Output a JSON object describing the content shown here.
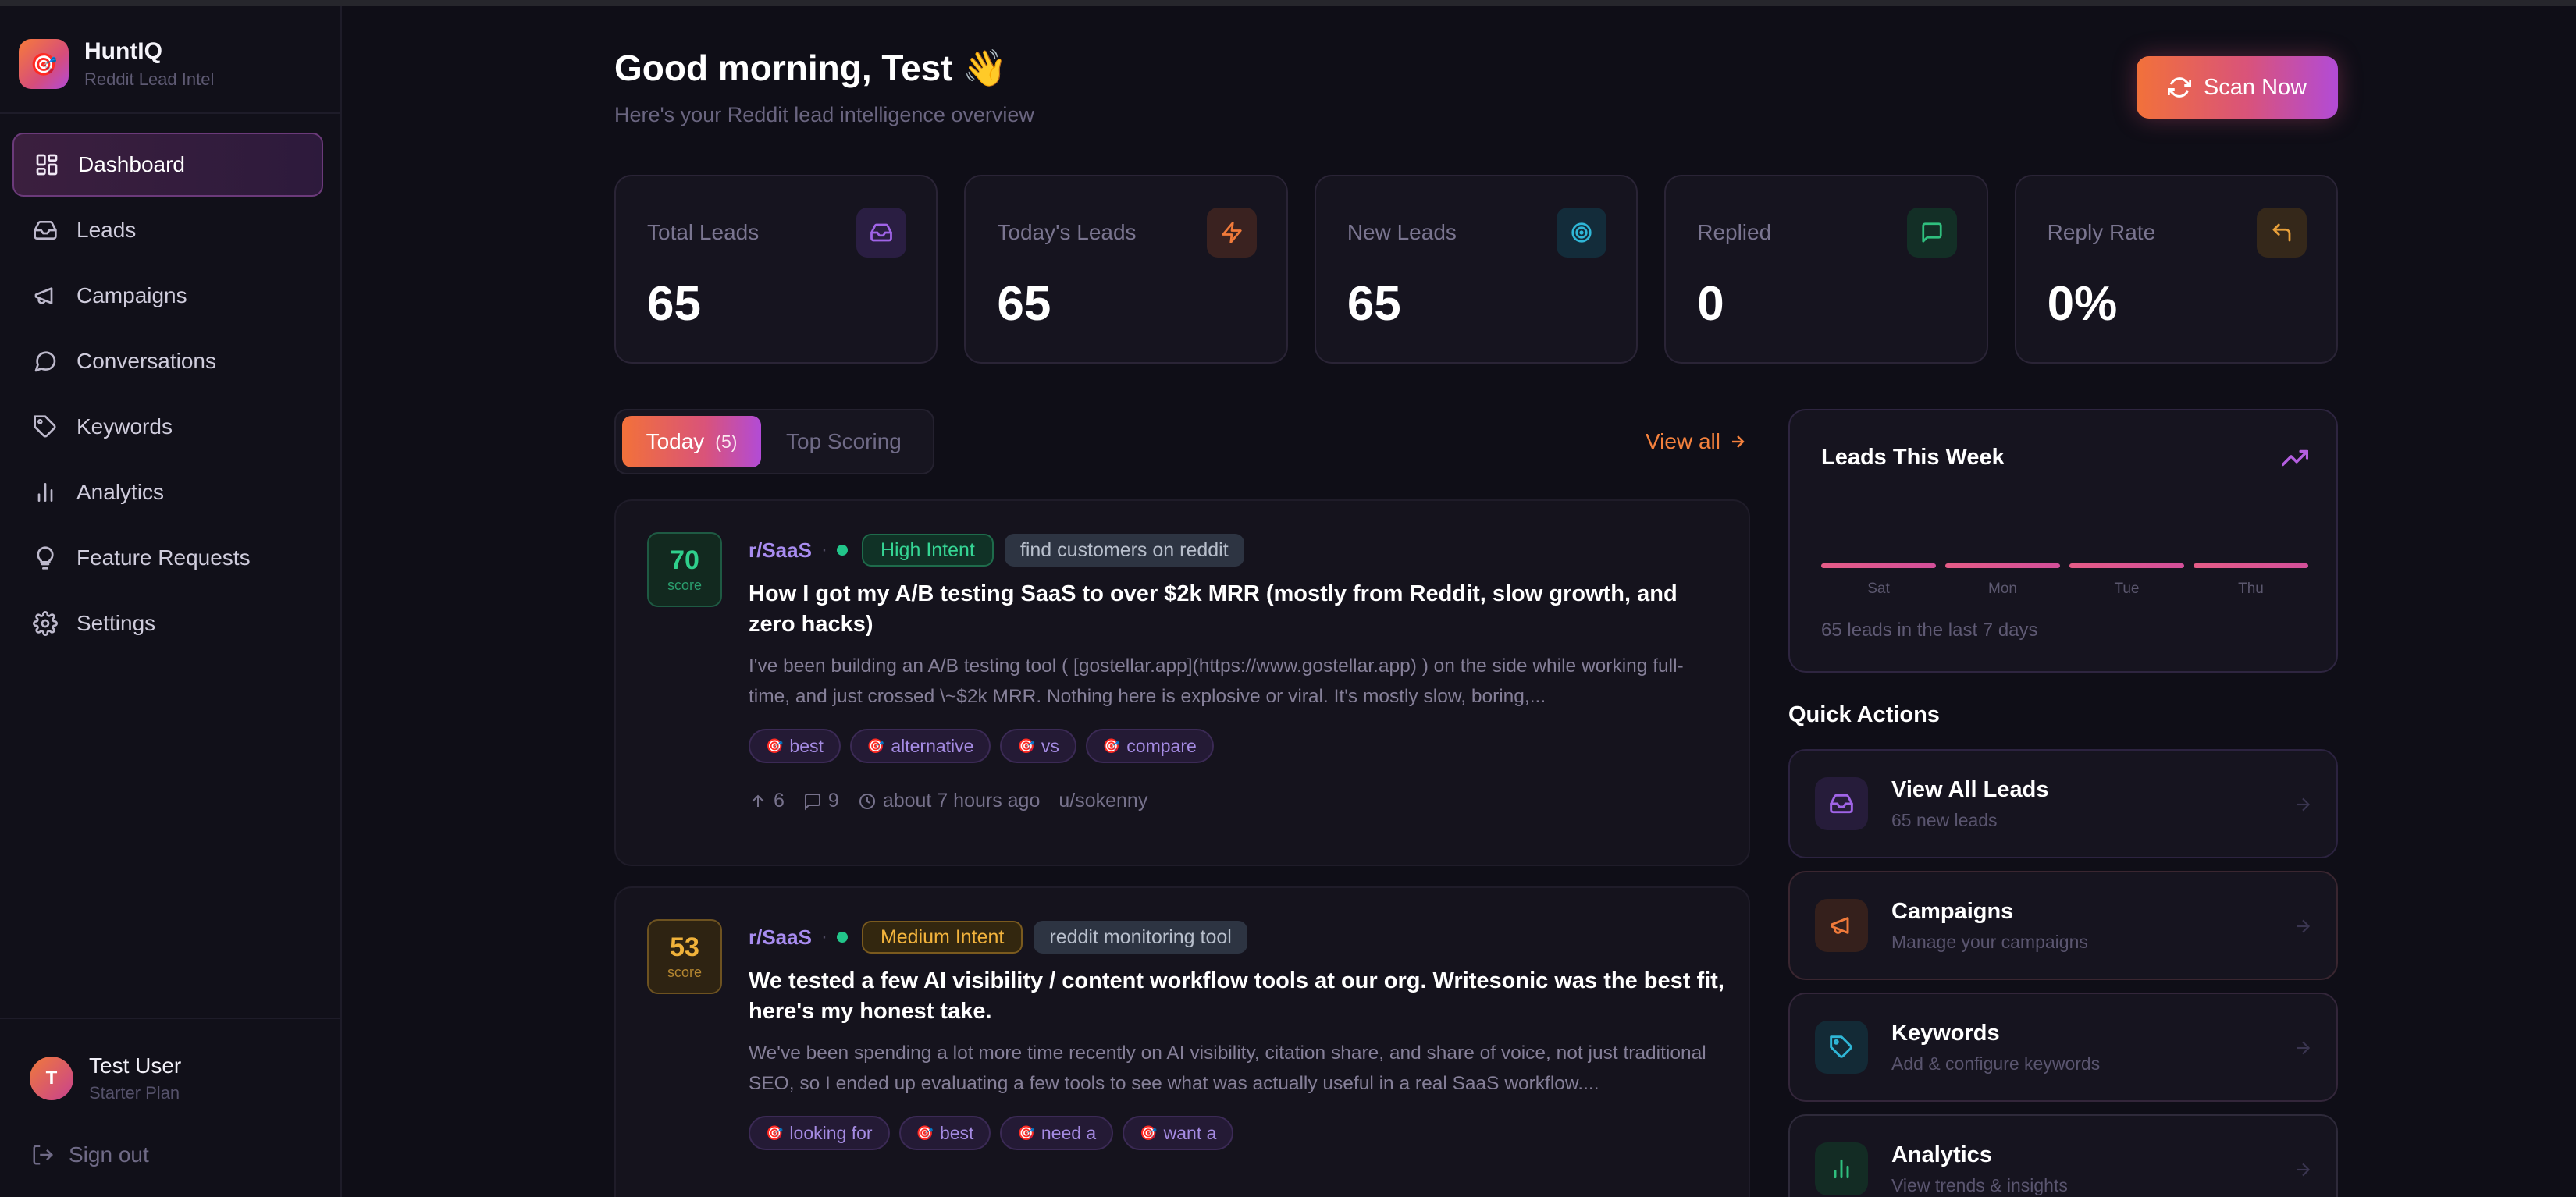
{
  "brand": {
    "name": "HuntIQ",
    "tagline": "Reddit Lead Intel"
  },
  "sidebar": {
    "items": [
      {
        "label": "Dashboard"
      },
      {
        "label": "Leads"
      },
      {
        "label": "Campaigns"
      },
      {
        "label": "Conversations"
      },
      {
        "label": "Keywords"
      },
      {
        "label": "Analytics"
      },
      {
        "label": "Feature Requests"
      },
      {
        "label": "Settings"
      }
    ],
    "active": "Dashboard"
  },
  "user": {
    "initial": "T",
    "name": "Test User",
    "plan": "Starter Plan",
    "signout": "Sign out"
  },
  "header": {
    "greeting": "Good morning, Test 👋",
    "subtitle": "Here's your Reddit lead intelligence overview",
    "scan_label": "Scan Now"
  },
  "stats": [
    {
      "label": "Total Leads",
      "value": "65",
      "icon": "inbox-icon",
      "color": "#a064e8"
    },
    {
      "label": "Today's Leads",
      "value": "65",
      "icon": "lightning-icon",
      "color": "#f07a3a"
    },
    {
      "label": "New Leads",
      "value": "65",
      "icon": "target-icon",
      "color": "#2fb6d6"
    },
    {
      "label": "Replied",
      "value": "0",
      "icon": "message-icon",
      "color": "#2fbf7e"
    },
    {
      "label": "Reply Rate",
      "value": "0%",
      "icon": "reply-icon",
      "color": "#e8a03a"
    }
  ],
  "tabs": {
    "today_label": "Today",
    "today_count": "(5)",
    "top_label": "Top Scoring",
    "view_all": "View all"
  },
  "leads": [
    {
      "score": "70",
      "score_label": "score",
      "subreddit": "r/SaaS",
      "intent": "High Intent",
      "keyword": "find customers on reddit",
      "title": "How I got my A/B testing SaaS to over $2k MRR (mostly from Reddit, slow growth, and zero hacks)",
      "excerpt": "I've been building an A/B testing tool ( [gostellar.app](https://www.gostellar.app) ) on the side while working full-time, and just crossed \\~$2k MRR. Nothing here is explosive or viral. It's mostly slow, boring,...",
      "tags": [
        "best",
        "alternative",
        "vs",
        "compare"
      ],
      "upvotes": "6",
      "comments": "9",
      "time": "about 7 hours ago",
      "author": "u/sokenny"
    },
    {
      "score": "53",
      "score_label": "score",
      "subreddit": "r/SaaS",
      "intent": "Medium Intent",
      "keyword": "reddit monitoring tool",
      "title": "We tested a few AI visibility / content workflow tools at our org. Writesonic was the best fit, here's my honest take.",
      "excerpt": "We've been spending a lot more time recently on AI visibility, citation share, and share of voice, not just traditional SEO, so I ended up evaluating a few tools to see what was actually useful in a real SaaS workflow....",
      "tags": [
        "looking for",
        "best",
        "need a",
        "want a"
      ]
    }
  ],
  "week": {
    "title": "Leads This Week",
    "days": [
      "Sat",
      "Mon",
      "Tue",
      "Thu"
    ],
    "footer": "65 leads in the last 7 days"
  },
  "quick_actions": {
    "title": "Quick Actions",
    "items": [
      {
        "label": "View All Leads",
        "sub": "65 new leads",
        "icon": "inbox-icon",
        "color": "#a064e8"
      },
      {
        "label": "Campaigns",
        "sub": "Manage your campaigns",
        "icon": "megaphone-icon",
        "color": "#f07a3a"
      },
      {
        "label": "Keywords",
        "sub": "Add & configure keywords",
        "icon": "tag-icon",
        "color": "#2fb6d6"
      },
      {
        "label": "Analytics",
        "sub": "View trends & insights",
        "icon": "bar-chart-icon",
        "color": "#2fbf7e"
      }
    ]
  }
}
